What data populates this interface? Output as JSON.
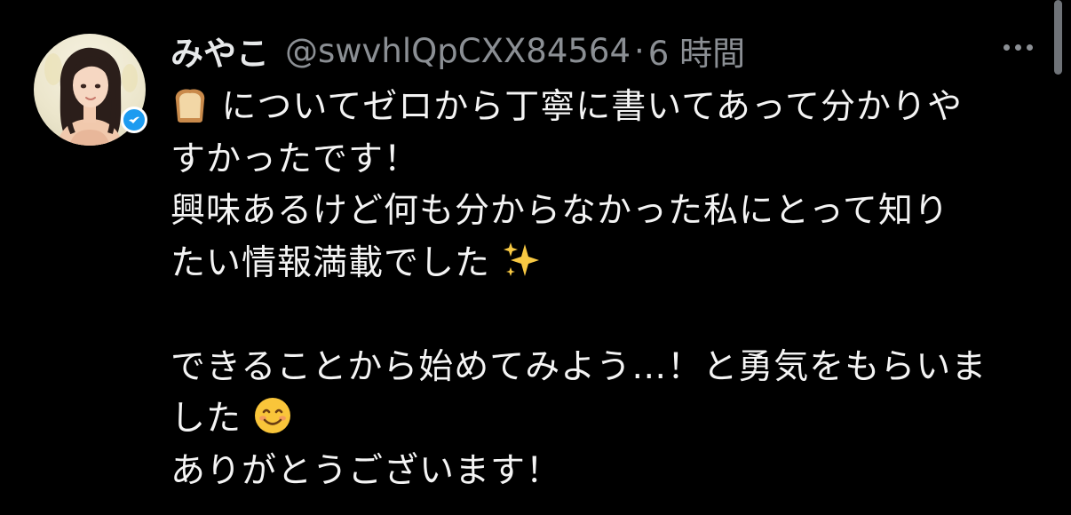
{
  "tweet": {
    "display_name": "みやこ",
    "handle": "@swvhlQpCXX84564",
    "separator": "·",
    "time": "6 時間",
    "body_lines": {
      "l1": "についてゼロから丁寧に書いてあって分かりや",
      "l2": "すかったです！",
      "l3": "興味あるけど何も分からなかった私にとって知り",
      "l4": "たい情報満載でした",
      "l5": "できることから始めてみよう…！と勇気をもらいま",
      "l6": "した",
      "l7": "ありがとうございます！"
    }
  },
  "icons": {
    "avatar": "avatar-illustration",
    "verified": "verified-badge-icon",
    "bread": "bread-emoji",
    "sparkles": "sparkles-emoji",
    "smile": "smiling-face-emoji",
    "more": "more-options-icon"
  },
  "colors": {
    "background": "#000000",
    "text": "#e7e9ea",
    "muted": "#8b8f94",
    "verified": "#1d9bf0"
  }
}
